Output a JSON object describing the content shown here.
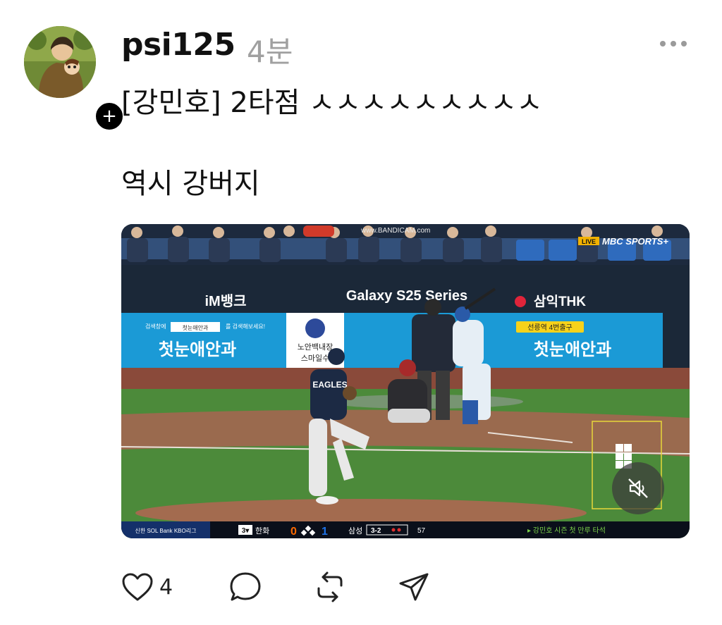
{
  "post": {
    "username": "psi125",
    "timestamp": "4분",
    "text_line1": "[강민호] 2타점 ㅅㅅㅅㅅㅅㅅㅅㅅㅅ",
    "text_line2": "역시 강버지",
    "like_count": "4"
  },
  "video": {
    "watermark": "www.BANDICAM.com",
    "broadcaster": "MBC SPORTS+",
    "live_badge": "LIVE",
    "ads": {
      "left_brand": "iM뱅크",
      "center_brand": "Galaxy S25 Series",
      "right_brand": "삼익THK",
      "clinic": "첫눈애안과",
      "clinic_search": "첫눈애안과",
      "clinic_tagline_left": "검색창에",
      "clinic_tagline_right": "를 검색해보세요!",
      "clinic_station": "선릉역 4번출구",
      "center_panel_line1": "노안백내장",
      "center_panel_line2": "스마일수"
    },
    "pitcher_jersey": "EAGLES",
    "scorebar": {
      "league": "신한 SOL Bank KBO리그",
      "inning": "3▾",
      "away_team": "한화",
      "away_score": "0",
      "home_score": "1",
      "home_team": "삼성",
      "count": "3-2",
      "pitch_count": "57",
      "ticker": "▸ 강민호 시즌 첫 만루 타석"
    }
  },
  "icons": {
    "like": "heart-icon",
    "reply": "comment-bubble-icon",
    "repost": "repost-icon",
    "share": "send-icon",
    "mute": "speaker-muted-icon",
    "follow": "plus-icon",
    "more": "more-dots-icon"
  },
  "colors": {
    "timestamp": "#a0a0a0",
    "ad_blue": "#1b9ad6",
    "ticker_green": "#7cd24a",
    "score_orange": "#ff6a00",
    "score_blue": "#1e73e8"
  }
}
